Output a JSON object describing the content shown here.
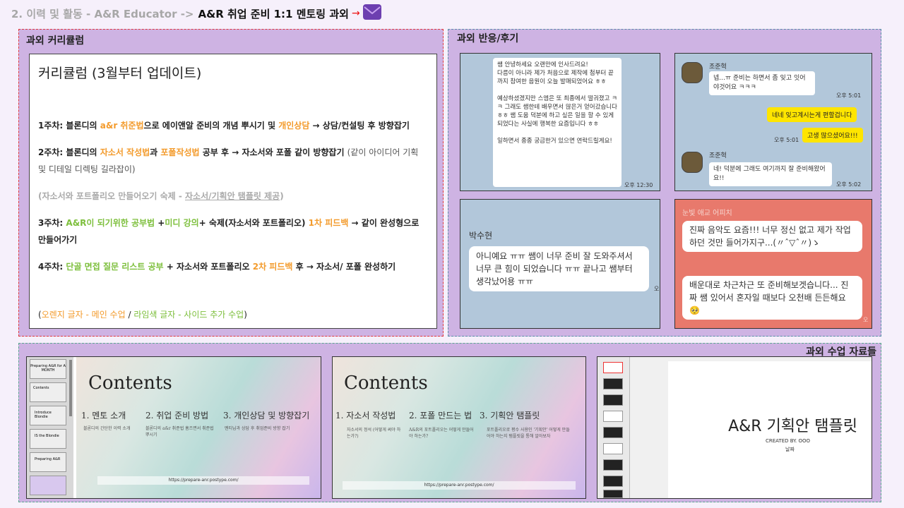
{
  "header": {
    "crumb": "2. 이력 및 활동 - A&R Educator ->",
    "title": "A&R 취업 준비 1:1 멘토링 과외",
    "icon": "envelope-icon"
  },
  "curriculum": {
    "panel_title": "과외 커리큘럼",
    "heading": "커리큘럼 (3월부터 업데이트)",
    "w1": {
      "a": "1주차: 블론디의 ",
      "b": "a&r 취준법",
      "c": "으로 에이앤알 준비의 개념 뿌시기 및 ",
      "d": "개인상담",
      "e": " → 상담/컨설팅 후 방향잡기"
    },
    "w2": {
      "a": "2주차: 블론디의 ",
      "b": "자소서 작성법",
      "c": "과 ",
      "d": "포폴작성법",
      "e": " 공부 후 → 자소서와 포폴 같이 방향잡기 ",
      "f": "(같이 아이디어 기획 및 디테일 디렉팅 길라잡이)"
    },
    "hw": {
      "a": "(자소서와 포트폴리오 만들어오기 숙제 - ",
      "b": "자소서/기획안 탬플릿 제공",
      "c": ")"
    },
    "w3": {
      "a": "3주차:  ",
      "b": "A&R이 되기위한 공부법",
      "c": " +",
      "d": "미디 강의",
      "e": "+ 숙제(자소서와 포트폴리오) ",
      "f": "1차 피드백",
      "g": " → 같이 완성형으로 만들어가기"
    },
    "w4": {
      "a": "4주차: ",
      "b": "단골 면접 질문 리스트 공부",
      "c": " + 자소서와 포트폴리오 ",
      "d": "2차 피드백",
      "e": " 후 → 자소서/ 포폴 완성하기"
    },
    "legend": {
      "a": "(",
      "b": "오렌지 글자 - 메인 수업",
      "c": " / ",
      "d": "라임색 글자 - 사이드 추가 수업",
      "e": ")"
    }
  },
  "reviews": {
    "panel_title": "과외 반응/후기",
    "c1": {
      "text": "쌤 안녕하세요 오랜만에 인사드려요!\n다름이 아니라 제가 처음으로 제작에 첨부터 끝까지 참여한 음원이 오늘 발매되었어요 ㅎㅎ\n\n예상하셨겠지만 스엠은 또 최종에서 떨궈졌고 ㅋㅋ 그래도 쌤한테 배우면서 많은거 얻어갔습니다 ㅎㅎ 쌤 도움 덕분에 하고 싶은 일을 할 수 있게 되었다는 사실에 행복한 요즘입니다 ㅎㅎ\n\n일하면서 종종 궁금한거 있으면 연락드릴게요!",
      "time": "오후 12:30"
    },
    "c2": {
      "name1": "조준혁",
      "msg1": "넵...ㅠ 준비는 하면서 좀 잊고 잇어야것어요 ㅋㅋㅋ",
      "t1": "오후 5:01",
      "y1": "네네 잊고계시는게 편할겁니다",
      "t2": "오후 5:01",
      "y2": "고생 많으셨어요!!!",
      "name2": "조준혁",
      "msg2": "네! 덕분에 그래도 여기까지 잘 준비해왔어요!!",
      "t3": "오후 5:02"
    },
    "c3": {
      "name": "박수현",
      "msg": "아니예요 ㅠㅠ 쌤이 너무 준비 잘 도와주셔서 너무 큰 힘이 되었습니다 ㅠㅠ 끝나고 쌤부터 생각났어용 ㅠㅠ",
      "edge": "오"
    },
    "c4": {
      "name": "눈빛 애교 어피치",
      "msg1": "진짜 음악도 요즘!!! 너무 정신 없고 제가 작업하던 것만 들어가지구...(〃ˆ▽ˆ〃)ゝ",
      "msg2": "배운대로 차근차근 또 준비해보겟습니다... 진짜 쌤 있어서 혼자일 때보다 오천배 든든해요🥺",
      "edge": "오"
    }
  },
  "materials": {
    "panel_title": "과외 수업 자료들",
    "s1": {
      "thumb1": "Preparing A&R for A MONTH",
      "thumb2": "Contents",
      "thumb3": "Introduce Blondie",
      "thumb4": "IS the Blondie",
      "thumb5": "Preparing A&R",
      "heading": "Contents",
      "items": [
        "1. 멘토 소개",
        "2. 취업 준비 방법",
        "3. 개인상담 및 방향잡기"
      ],
      "subs": [
        "블론디의 간단한 이력 소개",
        "블론디의 a&r 취준법 홈즈면서 취준법 뿌시기",
        "멘티님과 상담 후 취업준비 방향 잡기"
      ],
      "url": "https://prepare-anr.postype.com/"
    },
    "s2": {
      "heading": "Contents",
      "items": [
        "1. 자소서 작성법",
        "2. 포폴 만드는 법",
        "3. 기획안 탬플릿"
      ],
      "subs": [
        "자소서의 정석 (어떻게 써야 하는가?)",
        "A&R의 포트폴리오는 어떻게 만들어야 하는가?",
        "포트폴리오로 평수 사용인 '기획안' 어떻게 만들어야 하는지 탬플릿을 통해 알아보자"
      ],
      "url": "https://prepare-anr.postype.com/"
    },
    "s3": {
      "title": "A&R 기획안 탬플릿",
      "created": "CREATED BY. OOO",
      "date": "날짜"
    }
  },
  "colors": {
    "orange": "#f39b2c",
    "lime": "#7dbf3c",
    "panel": "#ceb3e3",
    "chat": "#b2c7da",
    "kakao_yellow": "#fee500",
    "peach": "#e8796c"
  }
}
